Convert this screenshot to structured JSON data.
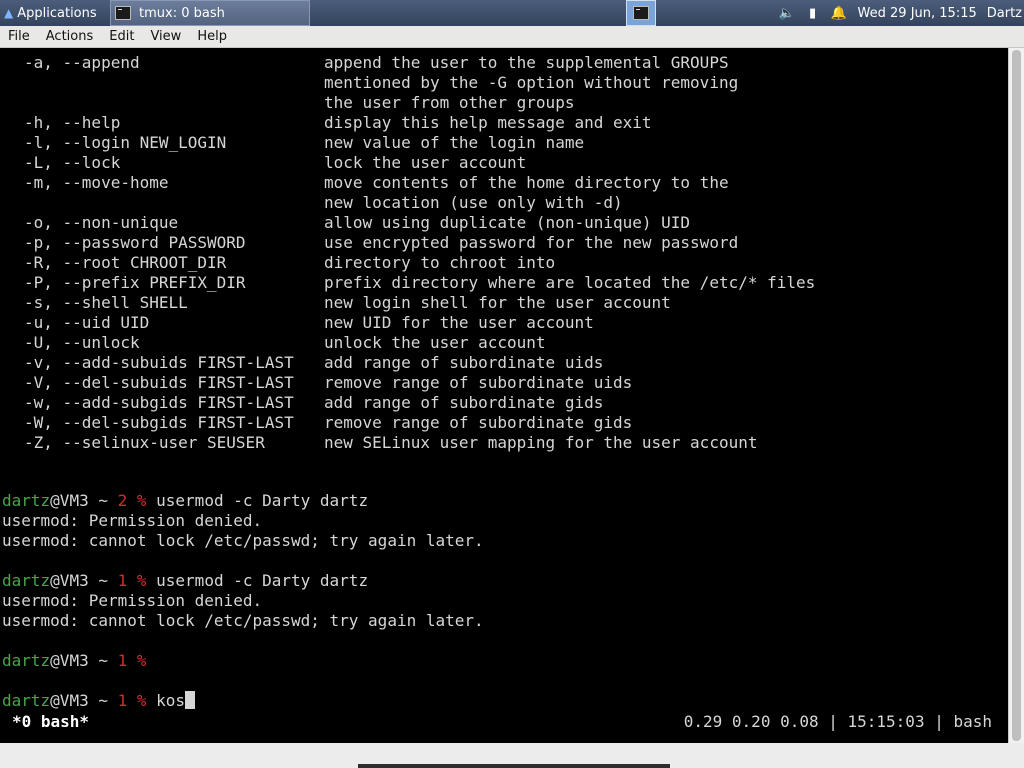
{
  "panel": {
    "applications_label": "Applications",
    "task_label": "tmux: 0 bash",
    "clock": "Wed 29 Jun, 15:15",
    "user": "Dartz",
    "icons": [
      "volume-icon",
      "battery-icon",
      "notification-bell-icon"
    ]
  },
  "menubar": {
    "items": [
      "File",
      "Actions",
      "Edit",
      "View",
      "Help"
    ]
  },
  "terminal": {
    "options": [
      {
        "opt": "-a, --append",
        "desc": "append the user to the supplemental GROUPS"
      },
      {
        "opt": "",
        "desc": "mentioned by the -G option without removing"
      },
      {
        "opt": "",
        "desc": "the user from other groups"
      },
      {
        "opt": "-h, --help",
        "desc": "display this help message and exit"
      },
      {
        "opt": "-l, --login NEW_LOGIN",
        "desc": "new value of the login name"
      },
      {
        "opt": "-L, --lock",
        "desc": "lock the user account"
      },
      {
        "opt": "-m, --move-home",
        "desc": "move contents of the home directory to the"
      },
      {
        "opt": "",
        "desc": "new location (use only with -d)"
      },
      {
        "opt": "-o, --non-unique",
        "desc": "allow using duplicate (non-unique) UID"
      },
      {
        "opt": "-p, --password PASSWORD",
        "desc": "use encrypted password for the new password"
      },
      {
        "opt": "-R, --root CHROOT_DIR",
        "desc": "directory to chroot into"
      },
      {
        "opt": "-P, --prefix PREFIX_DIR",
        "desc": "prefix directory where are located the /etc/* files"
      },
      {
        "opt": "-s, --shell SHELL",
        "desc": "new login shell for the user account"
      },
      {
        "opt": "-u, --uid UID",
        "desc": "new UID for the user account"
      },
      {
        "opt": "-U, --unlock",
        "desc": "unlock the user account"
      },
      {
        "opt": "-v, --add-subuids FIRST-LAST",
        "desc": "add range of subordinate uids"
      },
      {
        "opt": "-V, --del-subuids FIRST-LAST",
        "desc": "remove range of subordinate uids"
      },
      {
        "opt": "-w, --add-subgids FIRST-LAST",
        "desc": "add range of subordinate gids"
      },
      {
        "opt": "-W, --del-subgids FIRST-LAST",
        "desc": "remove range of subordinate gids"
      },
      {
        "opt": "-Z, --selinux-user SEUSER",
        "desc": "new SELinux user mapping for the user account"
      }
    ],
    "prompt_user": "dartz",
    "prompt_host": "@VM3 ~ ",
    "session": [
      {
        "code": "2 %",
        "cmd": " usermod -c Darty dartz",
        "output": [
          "usermod: Permission denied.",
          "usermod: cannot lock /etc/passwd; try again later."
        ]
      },
      {
        "code": "1 %",
        "cmd": " usermod -c Darty dartz",
        "output": [
          "usermod: Permission denied.",
          "usermod: cannot lock /etc/passwd; try again later."
        ]
      },
      {
        "code": "1 %",
        "cmd": "",
        "output": []
      },
      {
        "code": "1 %",
        "cmd": " kos",
        "output": []
      }
    ],
    "status_left": "*0 bash*",
    "status_right": "0.29 0.20 0.08 | 15:15:03 | bash"
  },
  "colors": {
    "prompt_user": "#48a54a",
    "exit_code": "#d12f2f",
    "panel": "#3d4d69"
  }
}
